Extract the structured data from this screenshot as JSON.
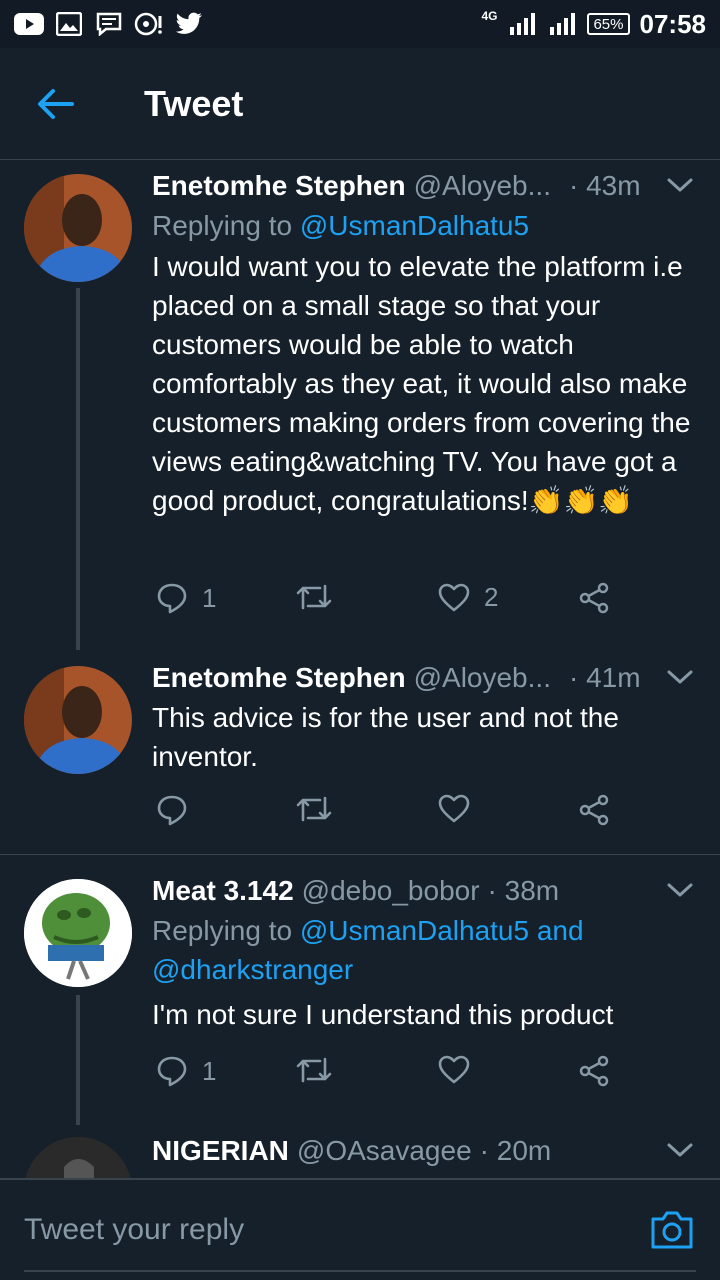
{
  "status_bar": {
    "network": "4G",
    "battery": "65%",
    "time": "07:58"
  },
  "header": {
    "title": "Tweet"
  },
  "tweets": [
    {
      "name": "Enetomhe Stephen",
      "handle": "@Aloyeb...",
      "time": "· 43m",
      "reply_prefix": "Replying to ",
      "reply_to": "@UsmanDalhatu5",
      "text": "I would want you to elevate the platform i.e placed on a small stage so that your customers would be able to watch comfortably as they eat, it would also make customers making orders from covering the views eating&watching TV. You have got a good product, congratulations!👏👏👏",
      "reply_count": "1",
      "like_count": "2"
    },
    {
      "name": "Enetomhe Stephen",
      "handle": "@Aloyeb...",
      "time": "· 41m",
      "text": "This advice is for the user and not the inventor.",
      "reply_count": "",
      "like_count": ""
    },
    {
      "name": "Meat 3.142",
      "handle": "@debo_bobor",
      "time": "· 38m",
      "reply_prefix": "Replying to ",
      "reply_to": "@UsmanDalhatu5 and @dharkstranger",
      "text": "I'm not sure I understand this product",
      "reply_count": "1",
      "like_count": ""
    },
    {
      "name": "NIGERIAN",
      "handle": "@OAsavagee",
      "time": "· 20m"
    }
  ],
  "reply_bar": {
    "placeholder": "Tweet your reply"
  },
  "colors": {
    "background": "#15202b",
    "accent": "#1da1f2",
    "secondary_text": "#8899a6",
    "divider": "#38444d"
  }
}
